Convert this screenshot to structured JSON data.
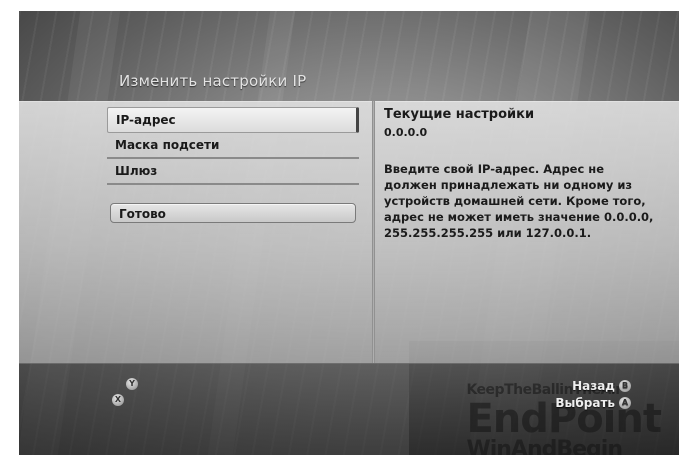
{
  "header": {
    "title": "Изменить настройки IP"
  },
  "menu": {
    "items": [
      {
        "label": "IP-адрес"
      },
      {
        "label": "Маска подсети"
      },
      {
        "label": "Шлюз"
      }
    ],
    "done_label": "Готово"
  },
  "info": {
    "title": "Текущие настройки",
    "value": "0.0.0.0",
    "description": "Введите свой IP-адрес. Адрес не должен принадлежать ни одному из устройств домашней сети. Кроме того, адрес не может иметь значение 0.0.0.0, 255.255.255.255 или 127.0.0.1."
  },
  "footer": {
    "back_label": "Назад",
    "back_button": "B",
    "select_label": "Выбрать",
    "select_button": "A",
    "y_button": "Y",
    "x_button": "X"
  },
  "watermark": {
    "line1": "KeepTheBallinTheAir",
    "line2": "EndPoint",
    "line3": "WinAndBegin"
  }
}
